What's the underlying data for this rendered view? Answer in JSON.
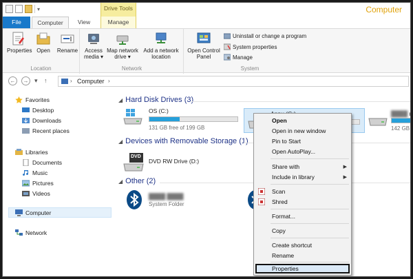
{
  "window": {
    "title": "Computer"
  },
  "contextual_tab_group": "Drive Tools",
  "tabs": [
    "File",
    "Computer",
    "View",
    "Manage"
  ],
  "ribbon": {
    "location": {
      "label": "Location",
      "buttons": [
        "Properties",
        "Open",
        "Rename"
      ]
    },
    "network": {
      "label": "Network",
      "access_media": [
        "Access",
        "media ▾"
      ],
      "map_network_drive": [
        "Map network",
        "drive ▾"
      ],
      "add_network_location": [
        "Add a network",
        "location"
      ]
    },
    "system": {
      "label": "System",
      "open_control_panel": [
        "Open Control",
        "Panel"
      ],
      "uninstall": "Uninstall or change a program",
      "system_properties": "System properties",
      "manage": "Manage"
    }
  },
  "nav": {
    "back": "←",
    "forward": "→",
    "recent": "▾",
    "up": "↑",
    "breadcrumb": "Computer",
    "sep": "›"
  },
  "sidebar": {
    "favorites": "Favorites",
    "favorites_items": [
      "Desktop",
      "Downloads",
      "Recent places"
    ],
    "libraries": "Libraries",
    "libraries_items": [
      "Documents",
      "Music",
      "Pictures",
      "Videos"
    ],
    "computer": "Computer",
    "network": "Network"
  },
  "content": {
    "hdd_header": "Hard Disk Drives (3)",
    "drive_c": {
      "name": "OS (C:)",
      "free": "131 GB free of 199 GB",
      "used_fraction": 0.34
    },
    "drive_g": {
      "name": "Anpu (G:)"
    },
    "drive_h": {
      "name": "(H",
      "free": "142 GB"
    },
    "removable_header": "Devices with Removable Storage (1)",
    "dvd": {
      "name": "DVD RW Drive (D:)",
      "badge": "DVD"
    },
    "other_header": "Other (2)",
    "bluetooth": {
      "sub": "System Folder"
    }
  },
  "context_menu": {
    "items": [
      "Open",
      "Open in new window",
      "Pin to Start",
      "Open AutoPlay...",
      "Share with",
      "Include in library",
      "Scan",
      "Shred",
      "Format...",
      "Copy",
      "Create shortcut",
      "Rename",
      "Properties"
    ]
  },
  "colors": {
    "file_tab": "#1979ca",
    "title": "#e0a20a",
    "drive_tools": "#f6ed9f",
    "group_header": "#1e3287",
    "progress": "#26a0da"
  }
}
